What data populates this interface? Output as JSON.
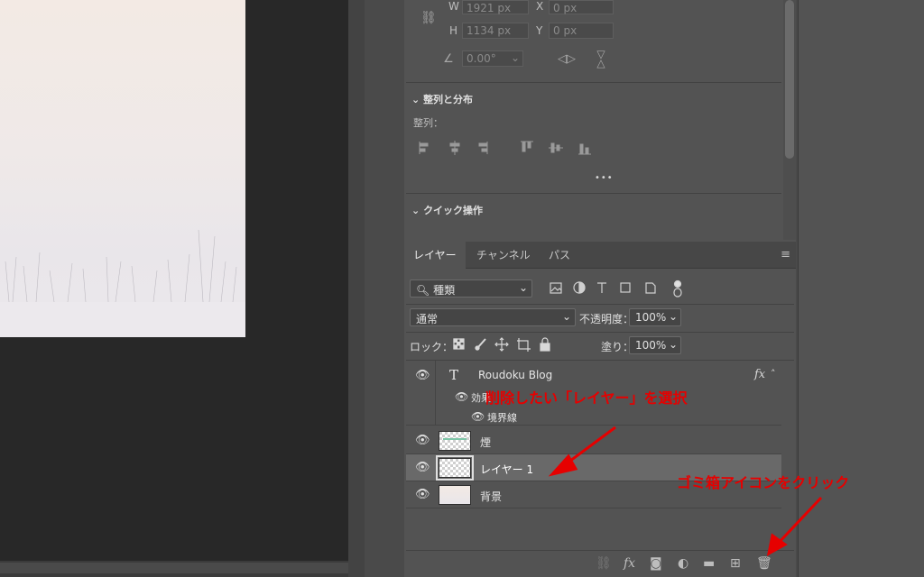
{
  "properties": {
    "w_label": "W",
    "w_value": "1921 px",
    "x_label": "X",
    "x_value": "0 px",
    "h_label": "H",
    "h_value": "1134 px",
    "y_label": "Y",
    "y_value": "0 px",
    "angle_value": "0.00°",
    "align_section": "整列と分布",
    "align_label": "整列：",
    "more": "•••",
    "quick_section": "クイック操作"
  },
  "layers_panel": {
    "tabs": [
      "レイヤー",
      "チャンネル",
      "パス"
    ],
    "filter_label": "種類",
    "blend_mode": "通常",
    "opacity_label": "不透明度：",
    "opacity_value": "100%",
    "lock_label": "ロック：",
    "fill_label": "塗り：",
    "fill_value": "100%",
    "layers": [
      {
        "name": "Roudoku Blog",
        "type": "text",
        "fx": "fx"
      },
      {
        "name": "効果",
        "type": "effect"
      },
      {
        "name": "境界線",
        "type": "effect-item"
      },
      {
        "name": "煙",
        "type": "image"
      },
      {
        "name": "レイヤー 1",
        "type": "empty",
        "selected": true
      },
      {
        "name": "背景",
        "type": "image"
      }
    ]
  },
  "annotations": {
    "select_layer": "削除したい「レイヤー」を選択",
    "click_trash": "ゴミ箱アイコンをクリック",
    "color": "#e60000"
  },
  "colors": {
    "panel": "#535353",
    "canvas_bg": "#282828",
    "selected_row": "#696969"
  }
}
